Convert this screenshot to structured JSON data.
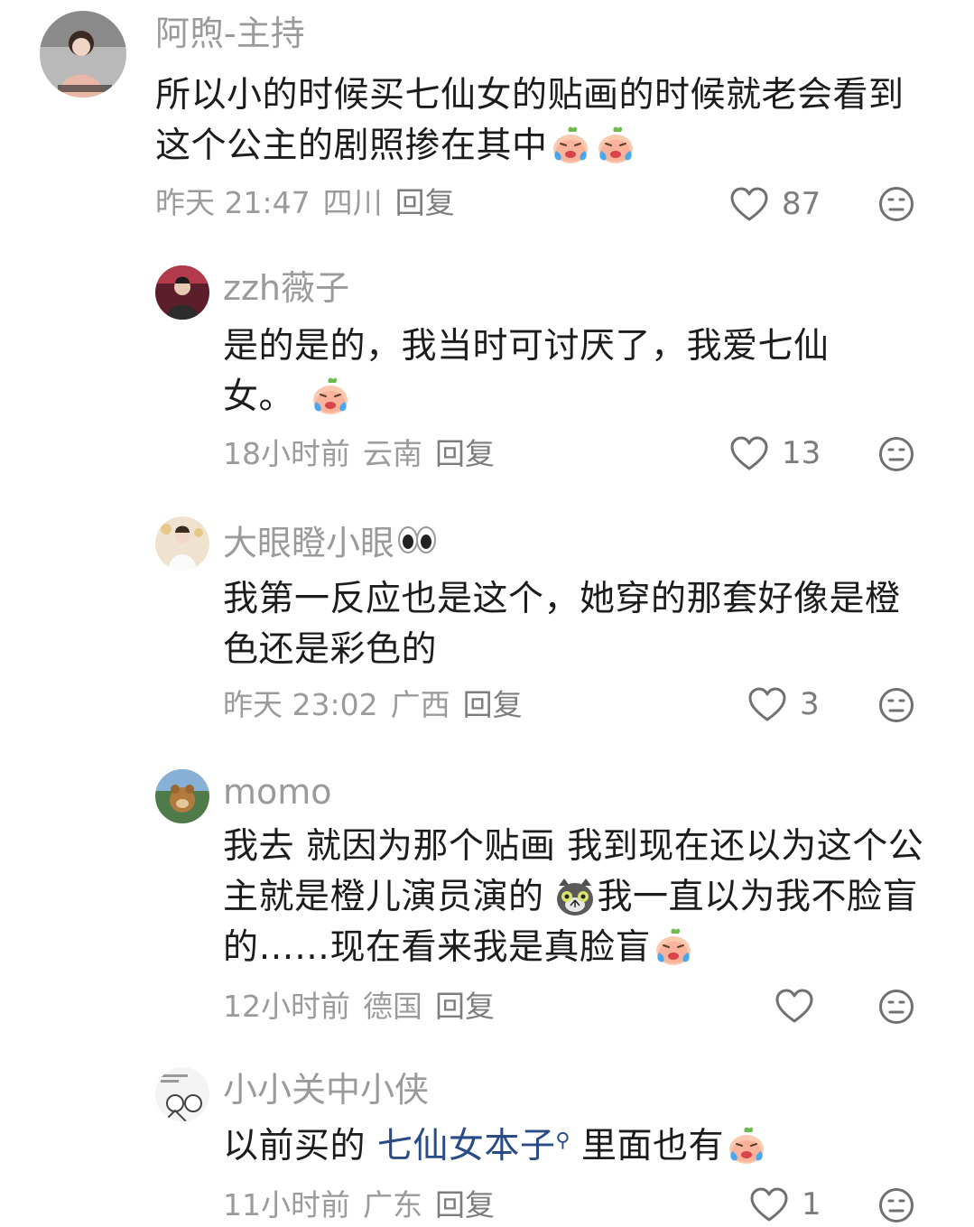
{
  "comments": [
    {
      "username": "阿煦-主持",
      "text_parts": [
        "所以小的时候买七仙女的贴画的时候就老会看到这个公主的剧照掺在其中"
      ],
      "meta": {
        "time": "昨天 21:47",
        "region": "四川",
        "reply_label": "回复"
      },
      "likes": "87"
    },
    {
      "username": "zzh薇子",
      "text_parts": [
        "是的是的，我当时可讨厌了，我爱七仙女。"
      ],
      "meta": {
        "time": "18小时前",
        "region": "云南",
        "reply_label": "回复"
      },
      "likes": "13"
    },
    {
      "username": "大眼瞪小眼",
      "text_parts": [
        "我第一反应也是这个，她穿的那套好像是橙色还是彩色的"
      ],
      "meta": {
        "time": "昨天 23:02",
        "region": "广西",
        "reply_label": "回复"
      },
      "likes": "3"
    },
    {
      "username": "momo",
      "text_parts": [
        "我去 就因为那个贴画 我到现在还以为这个公主就是橙儿演员演的",
        "我一直以为我不脸盲的……现在看来我是真脸盲"
      ],
      "meta": {
        "time": "12小时前",
        "region": "德国",
        "reply_label": "回复"
      },
      "likes": ""
    },
    {
      "username": "小小关中小侠",
      "text_parts": [
        "以前买的 ",
        "七仙女本子",
        "里面也有"
      ],
      "meta": {
        "time": "11小时前",
        "region": "广东",
        "reply_label": "回复"
      },
      "likes": "1"
    }
  ],
  "icons": {
    "like": "heart-outline-icon",
    "dislike": "neutral-face-icon",
    "emoji_cry": "crying-peach-emoji",
    "emoji_cat": "grey-cat-emoji",
    "emoji_eyes": "eyes-emoji",
    "search": "search-icon"
  },
  "colors": {
    "text": "#1c1c1c",
    "muted": "#9b9b9b",
    "link": "#2a4b86",
    "icon": "#7d7d7d"
  }
}
